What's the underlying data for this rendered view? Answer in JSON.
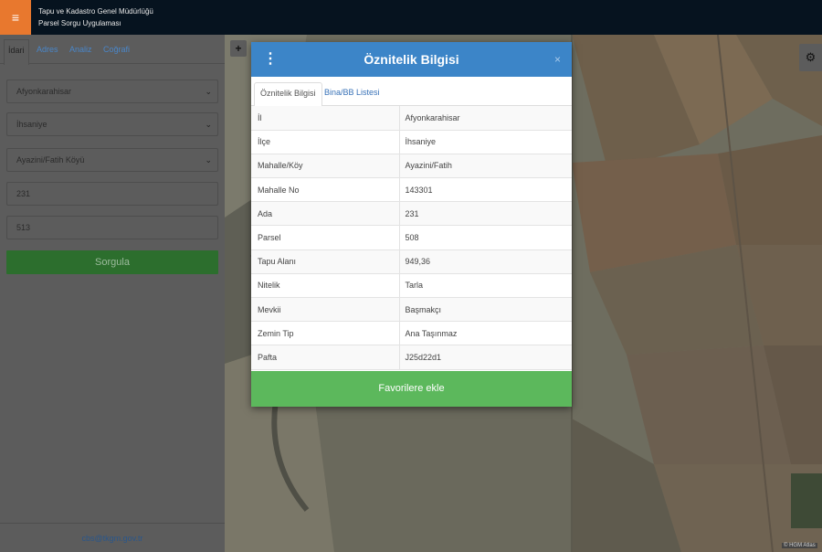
{
  "header": {
    "title_line1": "Tapu ve Kadastro Genel Müdürlüğü",
    "title_line2": "Parsel Sorgu Uygulaması",
    "menu_icon": "hamburger-icon"
  },
  "sidebar": {
    "tabs": [
      {
        "label": "İdari",
        "active": true
      },
      {
        "label": "Adres",
        "active": false
      },
      {
        "label": "Analiz",
        "active": false
      },
      {
        "label": "Coğrafi",
        "active": false
      }
    ],
    "fields": {
      "il": "Afyonkarahisar",
      "ilce": "İhsaniye",
      "mahalle": "Ayazini/Fatih Köyü",
      "ada": "231",
      "parsel": "513"
    },
    "query_button": "Sorgula",
    "footer_email": "cbs@tkgm.gov.tr"
  },
  "map": {
    "zoom_in": "+",
    "settings_icon": "gear-icon",
    "attribution": "© HGM Atlas"
  },
  "modal": {
    "title": "Öznitelik Bilgisi",
    "close": "×",
    "tabs": [
      {
        "label": "Öznitelik Bilgisi",
        "active": true
      },
      {
        "label": "Bina/BB Listesi",
        "active": false
      }
    ],
    "rows": [
      {
        "key": "İl",
        "value": "Afyonkarahisar"
      },
      {
        "key": "İlçe",
        "value": "İhsaniye"
      },
      {
        "key": "Mahalle/Köy",
        "value": "Ayazini/Fatih"
      },
      {
        "key": "Mahalle No",
        "value": "143301"
      },
      {
        "key": "Ada",
        "value": "231"
      },
      {
        "key": "Parsel",
        "value": "508"
      },
      {
        "key": "Tapu Alanı",
        "value": "949,36"
      },
      {
        "key": "Nitelik",
        "value": "Tarla"
      },
      {
        "key": "Mevkii",
        "value": "Başmakçı"
      },
      {
        "key": "Zemin Tip",
        "value": "Ana Taşınmaz"
      },
      {
        "key": "Pafta",
        "value": "J25d22d1"
      }
    ],
    "favorite_button": "Favorilere ekle"
  },
  "colors": {
    "header_bg": "#06131f",
    "menu_accent": "#e8782e",
    "modal_header": "#3c85c8",
    "favorite_green": "#5cb85c",
    "query_green": "#2c6e2d"
  }
}
